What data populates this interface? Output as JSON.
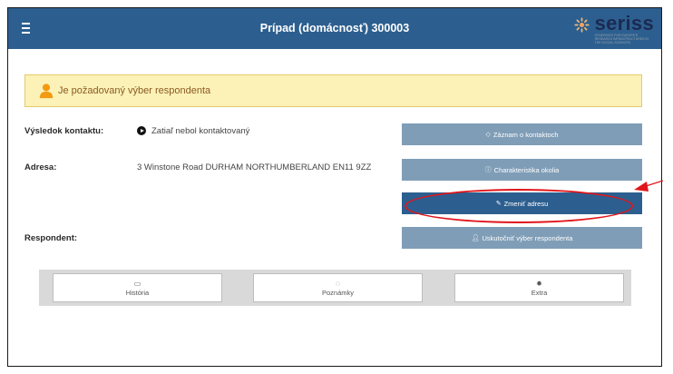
{
  "header": {
    "title": "Prípad (domácnosť) 300003",
    "logo_text": "seriss",
    "logo_sub": "SYNERGIES FOR EUROPE'S RESEARCH INFRASTRUCTURES IN THE SOCIAL SCIENCES",
    "menu_icon": "hamburger-icon"
  },
  "alert": {
    "text": "Je požadovaný výber respondenta",
    "icon": "user-icon",
    "color": "#fcf2b8"
  },
  "fields": {
    "contact_result_label": "Výsledok kontaktu:",
    "contact_result_value": "Zatiaľ nebol kontaktovaný",
    "address_label": "Adresa:",
    "address_value": "3 Winstone Road DURHAM NORTHUMBERLAND EN11 9ZZ",
    "respondent_label": "Respondent:"
  },
  "actions": {
    "contact_log": "Záznam o kontaktoch",
    "neighborhood": "Charakteristika okolia",
    "change_address": "Zmeniť adresu",
    "select_respondent": "Uskutočniť výber respondenta"
  },
  "toolbar": {
    "history": "História",
    "notes": "Poznámky",
    "extra": "Extra"
  },
  "colors": {
    "header": "#2c5f8f",
    "button_light": "#7f9db7",
    "button_dark": "#2c5f8f",
    "annotation": "#e0161b"
  }
}
